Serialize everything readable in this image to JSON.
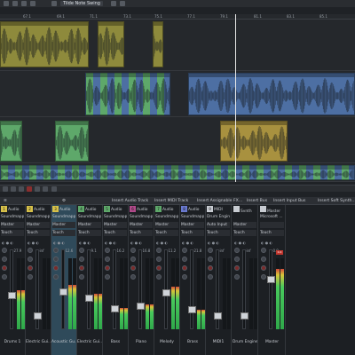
{
  "toolbar": {
    "snap_label": "Tilde Note Swing"
  },
  "ruler": {
    "marks": [
      "67.1",
      "69.1",
      "71.1",
      "73.1",
      "75.1",
      "77.1",
      "79.1",
      "81.1",
      "83.1",
      "85.1"
    ]
  },
  "mixer_toolbar": {
    "insert_audio": "Insert Audio Track",
    "insert_midi": "Insert MIDI Track",
    "insert_fx": "Insert Assignable FX...",
    "insert_bus": "Insert Bus",
    "insert_input_bus": "Insert Input Bus",
    "insert_synth": "Insert Soft Synth..."
  },
  "strips": [
    {
      "num": "1",
      "type": "Audio",
      "plugin": "Soundmapper",
      "out": "Master",
      "auto": "Touch",
      "db": "-27.9",
      "name": "Drums 1",
      "color": "#d6c04a"
    },
    {
      "num": "2",
      "type": "Audio",
      "plugin": "Soundmapper",
      "out": "Master",
      "auto": "Touch",
      "db": "-inf",
      "name": "Electric Gui...",
      "color": "#d6c04a"
    },
    {
      "num": "3",
      "type": "Audio",
      "plugin": "Soundmapper",
      "out": "Master",
      "auto": "Touch",
      "db": "-12.6",
      "name": "Acoustic Gu...",
      "color": "#d6c04a"
    },
    {
      "num": "4",
      "type": "Audio",
      "plugin": "Soundmapper",
      "out": "Master",
      "auto": "Touch",
      "db": "-9.1",
      "name": "Electric Gui...",
      "color": "#5ea86a"
    },
    {
      "num": "5",
      "type": "Audio",
      "plugin": "Soundmapper",
      "out": "Master",
      "auto": "Touch",
      "db": "-16.2",
      "name": "Bass",
      "color": "#5ea86a"
    },
    {
      "num": "6",
      "type": "Audio",
      "plugin": "Soundmapper",
      "out": "Master",
      "auto": "Touch",
      "db": "-16.8",
      "name": "Piano",
      "color": "#b04a8a"
    },
    {
      "num": "7",
      "type": "Audio",
      "plugin": "Soundmapper",
      "out": "Master",
      "auto": "Touch",
      "db": "-11.2",
      "name": "Melody",
      "color": "#5ea86a"
    },
    {
      "num": "8",
      "type": "Audio",
      "plugin": "Soundmapper",
      "out": "Master",
      "auto": "Touch",
      "db": "-21.8",
      "name": "Brass",
      "color": "#6a7ad0"
    },
    {
      "num": "9",
      "type": "MIDI",
      "plugin": "Drum Engine",
      "out": "Auto Input",
      "auto": "Touch",
      "db": "-inf",
      "name": "MIDI1",
      "color": "#c8ccd2"
    },
    {
      "num": "",
      "type": "Synth",
      "plugin": "",
      "out": "Master",
      "auto": "Touch",
      "db": "-inf",
      "name": "Drum Engine",
      "color": "#c8ccd2"
    },
    {
      "num": "",
      "type": "Master",
      "plugin": "Microsoft ...",
      "out": "",
      "auto": "Touch",
      "db": "-0.8",
      "name": "Master",
      "color": "#c8ccd2"
    }
  ],
  "master_peak": "0.4",
  "levels": [
    0.55,
    0,
    0.62,
    0.5,
    0.3,
    0.35,
    0.6,
    0.28,
    0,
    0,
    0.85
  ],
  "colors": {
    "accent": "#3d9bd6",
    "selected_strip": "#2f4a5a"
  }
}
